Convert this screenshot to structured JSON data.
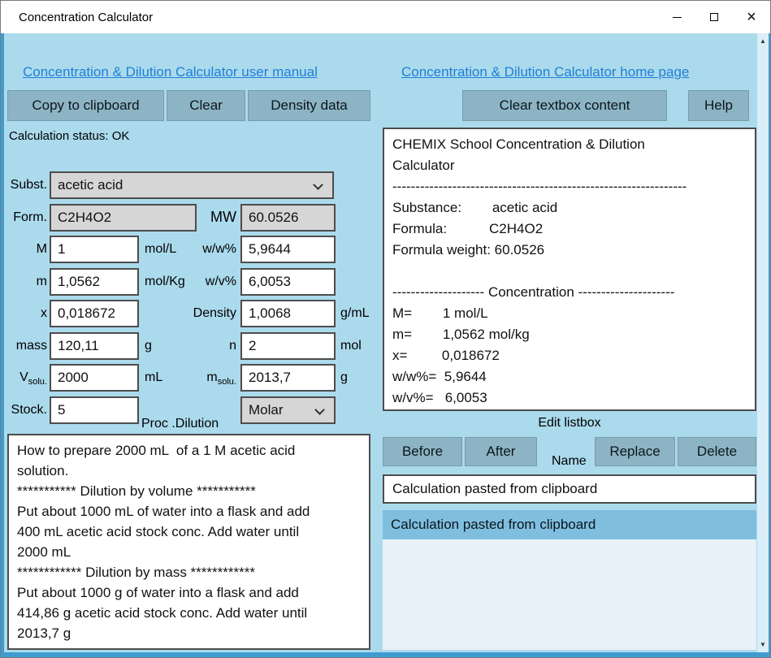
{
  "window": {
    "title": "Concentration Calculator"
  },
  "links": {
    "manual": "Concentration & Dilution Calculator user manual",
    "home": "Concentration & Dilution Calculator home page"
  },
  "toolbar": {
    "copy": "Copy to clipboard",
    "clear": "Clear",
    "density": "Density data",
    "clear_textbox": "Clear textbox content",
    "help": "Help"
  },
  "status": "Calculation status: OK",
  "form": {
    "subst_label": "Subst.",
    "substance": "acetic acid",
    "form_label": "Form.",
    "formula": "C2H4O2",
    "mw_label": "MW",
    "mw_value": "60.0526",
    "m_label": "M",
    "m_value": "1",
    "m_unit": "mol/L",
    "ww_label": "w/w%",
    "ww_value": "5,9644",
    "molal_label": "m",
    "molal_value": "1,0562",
    "molal_unit": "mol/Kg",
    "wv_label": "w/v%",
    "wv_value": "6,0053",
    "x_label": "x",
    "x_value": "0,018672",
    "density_label": "Density",
    "density_value": "1,0068",
    "density_unit": "g/mL",
    "mass_label": "mass",
    "mass_value": "120,11",
    "mass_unit": "g",
    "n_label": "n",
    "n_value": "2",
    "n_unit": "mol",
    "vsolu_label_main": "V",
    "vsolu_label_sub": "solu.",
    "vsolu_value": "2000",
    "vsolu_unit": "mL",
    "msolu_label_main": "m",
    "msolu_label_sub": "solu.",
    "msolu_value": "2013,7",
    "msolu_unit": "g",
    "stock_label": "Stock.",
    "stock_value": "5",
    "proc_label": "Proc .Dilution",
    "proc_value": "Molar"
  },
  "instructions": "How to prepare 2000 mL  of a 1 M acetic acid\nsolution.\n*********** Dilution by volume ***********\nPut about 1000 mL of water into a flask and add\n400 mL acetic acid stock conc. Add water until\n2000 mL\n************ Dilution by mass ************\nPut about 1000 g of water into a flask and add\n414,86 g acetic acid stock conc. Add water until\n2013,7 g",
  "output": "CHEMIX School Concentration & Dilution\nCalculator\n----------------------------------------------------------------\nSubstance:        acetic acid\nFormula:           C2H4O2\nFormula weight: 60.0526\n\n-------------------- Concentration ---------------------\nM=        1 mol/L\nm=        1,0562 mol/kg\nx=         0,018672\nw/w%=  5,9644\nw/v%=   6,0053",
  "edit": {
    "heading": "Edit listbox",
    "before": "Before",
    "after": "After",
    "name_label": "Name",
    "replace": "Replace",
    "delete": "Delete",
    "name_value": "Calculation pasted from clipboard",
    "items": [
      {
        "label": "Calculation pasted from clipboard",
        "selected": true
      }
    ]
  }
}
